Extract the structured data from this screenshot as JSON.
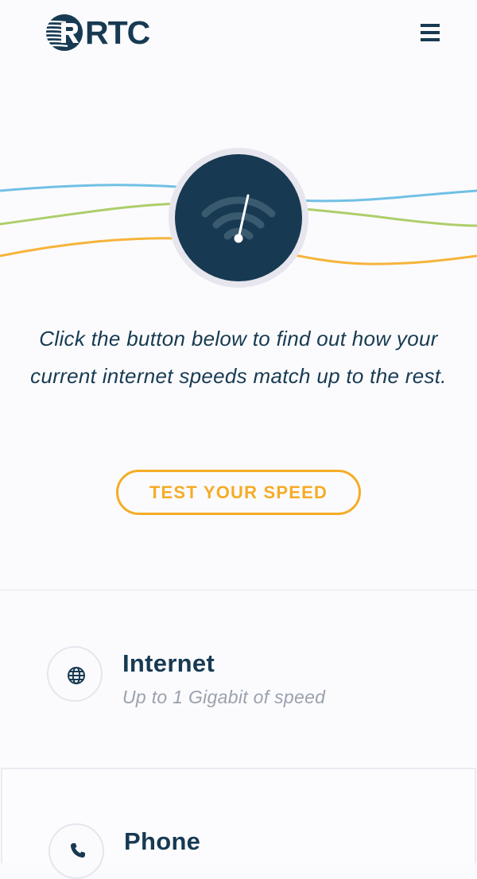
{
  "header": {
    "logo_text": "RTC",
    "menu_icon": "hamburger-menu-icon"
  },
  "hero": {
    "gauge_icon": "speed-gauge-icon",
    "line_colors": [
      "#62b9e2",
      "#a4c95a",
      "#f5ac26"
    ],
    "disc_color": "#173a52",
    "intro_text": "Click the button below to find out how your current internet speeds match up to the rest.",
    "cta_label": "TEST YOUR SPEED",
    "accent_color": "#f5ac26"
  },
  "services": [
    {
      "title": "Internet",
      "description": "Up to 1 Gigabit of speed",
      "icon": "globe-icon"
    },
    {
      "title": "Phone",
      "icon": "phone-icon"
    }
  ]
}
